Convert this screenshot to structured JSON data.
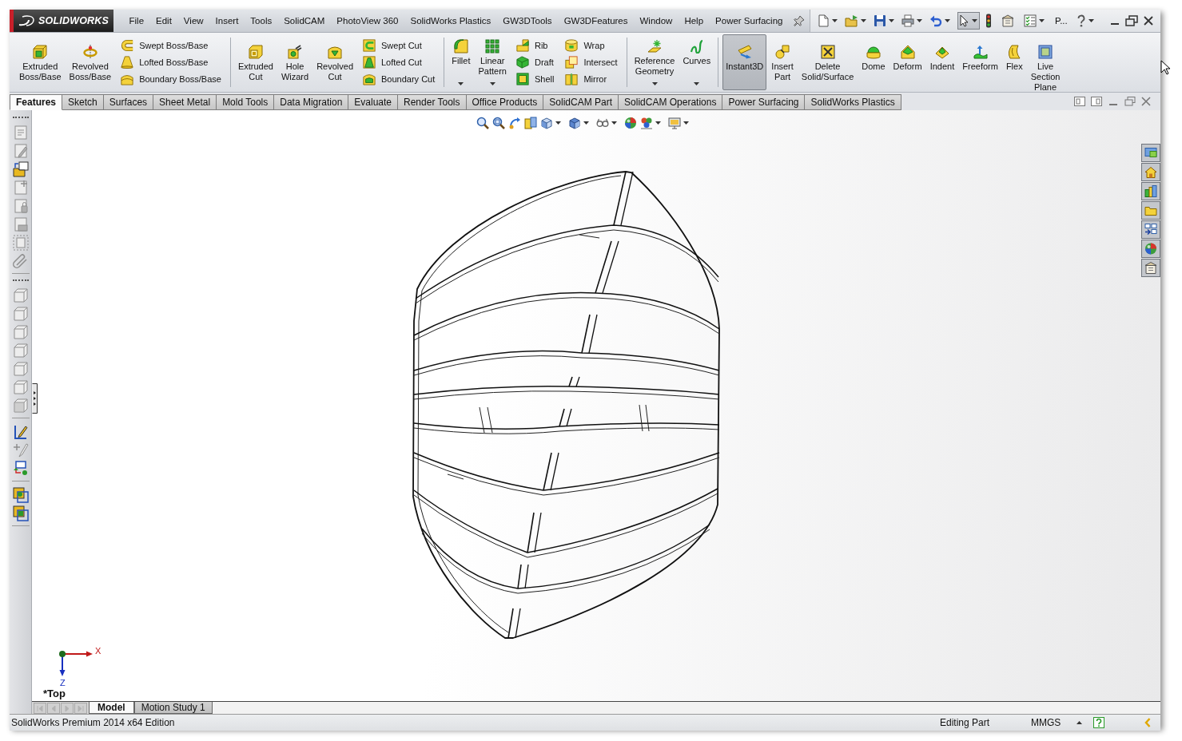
{
  "logo": {
    "text": "SOLIDWORKS"
  },
  "menu_bar": [
    "File",
    "Edit",
    "View",
    "Insert",
    "Tools",
    "SolidCAM",
    "PhotoView 360",
    "SolidWorks Plastics",
    "GW3DTools",
    "GW3DFeatures",
    "Window",
    "Help",
    "Power Surfacing"
  ],
  "quick_access": {
    "select_tool_on": true,
    "label": "P..."
  },
  "command_manager": {
    "groups": [
      {
        "tools": [
          {
            "kind": "large",
            "label": "Extruded Boss/Base",
            "dropdown": false,
            "on": false
          },
          {
            "kind": "large",
            "label": "Revolved Boss/Base",
            "dropdown": false,
            "on": false
          },
          {
            "kind": "stack",
            "items": [
              {
                "label": "Swept Boss/Base"
              },
              {
                "label": "Lofted Boss/Base"
              },
              {
                "label": "Boundary Boss/Base"
              }
            ]
          }
        ]
      },
      {
        "tools": [
          {
            "kind": "large",
            "label": "Extruded Cut",
            "dropdown": false,
            "on": false
          },
          {
            "kind": "large",
            "label": "Hole Wizard",
            "dropdown": false,
            "on": false
          },
          {
            "kind": "large",
            "label": "Revolved Cut",
            "dropdown": false,
            "on": false
          },
          {
            "kind": "stack",
            "items": [
              {
                "label": "Swept Cut"
              },
              {
                "label": "Lofted Cut"
              },
              {
                "label": "Boundary Cut"
              }
            ]
          }
        ]
      },
      {
        "tools": [
          {
            "kind": "large",
            "label": "Fillet",
            "dropdown": true,
            "on": false
          },
          {
            "kind": "large",
            "label": "Linear Pattern",
            "dropdown": true,
            "on": false
          },
          {
            "kind": "stack",
            "items": [
              {
                "label": "Rib"
              },
              {
                "label": "Draft"
              },
              {
                "label": "Shell"
              }
            ]
          },
          {
            "kind": "stack",
            "items": [
              {
                "label": "Wrap"
              },
              {
                "label": "Intersect"
              },
              {
                "label": "Mirror"
              }
            ]
          }
        ]
      },
      {
        "tools": [
          {
            "kind": "large",
            "label": "Reference Geometry",
            "dropdown": true,
            "on": false
          },
          {
            "kind": "large",
            "label": "Curves",
            "dropdown": true,
            "on": false
          }
        ]
      },
      {
        "tools": [
          {
            "kind": "large",
            "label": "Instant3D",
            "dropdown": false,
            "on": true
          },
          {
            "kind": "large",
            "label": "Insert Part",
            "dropdown": false,
            "on": false
          },
          {
            "kind": "large",
            "label": "Delete Solid/Surface",
            "dropdown": false,
            "on": false
          },
          {
            "kind": "large",
            "label": "Dome",
            "dropdown": false,
            "on": false
          },
          {
            "kind": "large",
            "label": "Deform",
            "dropdown": false,
            "on": false
          },
          {
            "kind": "large",
            "label": "Indent",
            "dropdown": false,
            "on": false
          },
          {
            "kind": "large",
            "label": "Freeform",
            "dropdown": false,
            "on": false
          },
          {
            "kind": "large",
            "label": "Flex",
            "dropdown": false,
            "on": false
          },
          {
            "kind": "large",
            "label": "Live Section Plane",
            "dropdown": false,
            "on": false
          }
        ]
      }
    ]
  },
  "tabs": [
    {
      "label": "Features",
      "selected": true
    },
    {
      "label": "Sketch",
      "selected": false
    },
    {
      "label": "Surfaces",
      "selected": false
    },
    {
      "label": "Sheet Metal",
      "selected": false
    },
    {
      "label": "Mold Tools",
      "selected": false
    },
    {
      "label": "Data Migration",
      "selected": false
    },
    {
      "label": "Evaluate",
      "selected": false
    },
    {
      "label": "Render Tools",
      "selected": false
    },
    {
      "label": "Office Products",
      "selected": false
    },
    {
      "label": "SolidCAM Part",
      "selected": false
    },
    {
      "label": "SolidCAM Operations",
      "selected": false
    },
    {
      "label": "Power Surfacing",
      "selected": false
    },
    {
      "label": "SolidWorks Plastics",
      "selected": false
    }
  ],
  "left_toolbar": {
    "groups": [
      {
        "items": [
          {
            "disabled": true
          },
          {
            "disabled": true
          },
          {
            "disabled": false
          },
          {
            "disabled": true
          },
          {
            "disabled": true
          },
          {
            "disabled": true
          },
          {
            "disabled": true
          },
          {
            "disabled": true
          }
        ]
      },
      {
        "items": [
          {
            "disabled": true
          },
          {
            "disabled": true
          },
          {
            "disabled": true
          },
          {
            "disabled": true
          },
          {
            "disabled": true
          },
          {
            "disabled": true
          },
          {
            "disabled": true
          }
        ]
      },
      {
        "items": [
          {
            "disabled": false
          },
          {
            "disabled": true
          },
          {
            "disabled": false
          }
        ]
      },
      {
        "items": [
          {
            "disabled": false
          },
          {
            "disabled": false
          }
        ]
      }
    ]
  },
  "graphics_area": {
    "view_name": "*Top",
    "triad": {
      "x_label": "X",
      "z_label": "Z"
    }
  },
  "tab_scroll_buttons": [
    {
      "disabled": true
    },
    {
      "disabled": true
    },
    {
      "disabled": true
    },
    {
      "disabled": true
    }
  ],
  "bottom_tabs": [
    {
      "label": "Model",
      "selected": true
    },
    {
      "label": "Motion Study 1",
      "selected": false
    }
  ],
  "status_bar": {
    "edition": "SolidWorks Premium 2014 x64 Edition",
    "mode": "Editing Part",
    "units": "MMGS"
  }
}
